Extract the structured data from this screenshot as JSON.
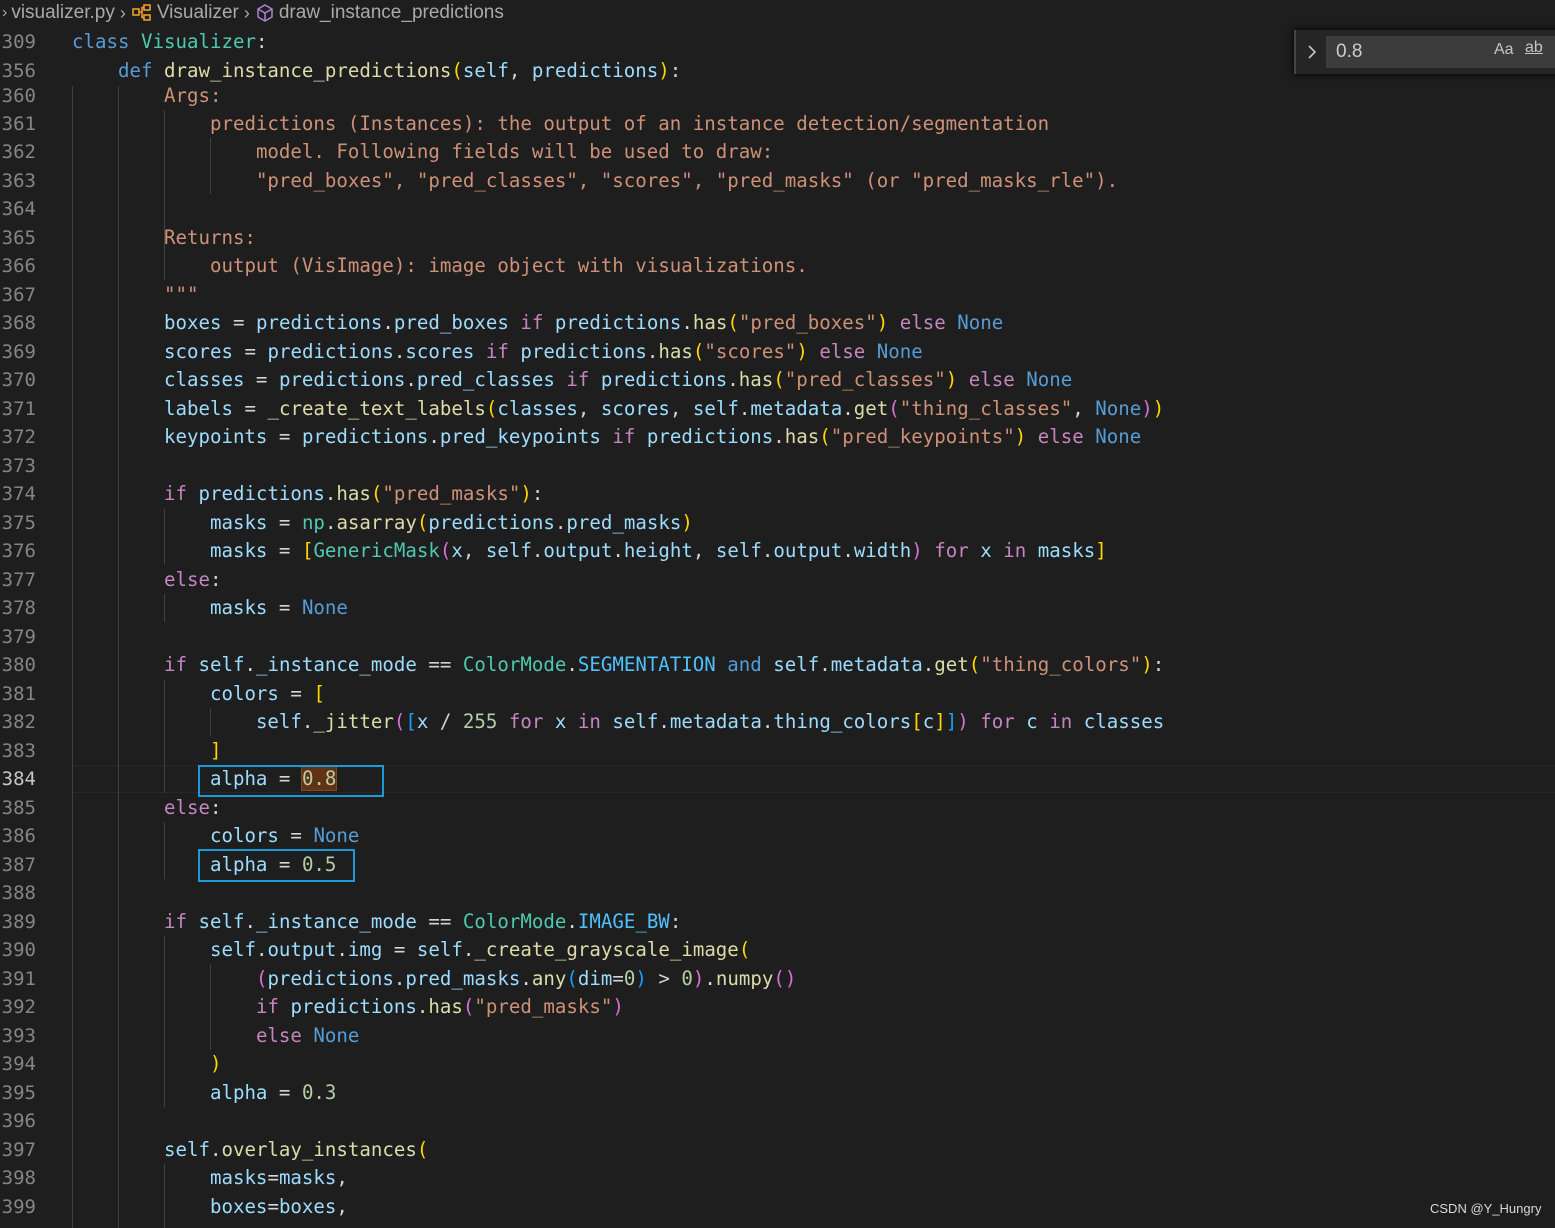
{
  "breadcrumb": {
    "file": "visualizer.py",
    "class_name": "Visualizer",
    "method_name": "draw_instance_predictions"
  },
  "find_widget": {
    "query": "0.8",
    "match_case_label": "Aa",
    "whole_word_label": "ab"
  },
  "watermark": "CSDN @Y_Hungry",
  "active_line": "384",
  "line_numbers": {
    "l309": "309",
    "l356": "356",
    "l360": "360",
    "l361": "361",
    "l362": "362",
    "l363": "363",
    "l364": "364",
    "l365": "365",
    "l366": "366",
    "l367": "367",
    "l368": "368",
    "l369": "369",
    "l370": "370",
    "l371": "371",
    "l372": "372",
    "l373": "373",
    "l374": "374",
    "l375": "375",
    "l376": "376",
    "l377": "377",
    "l378": "378",
    "l379": "379",
    "l380": "380",
    "l381": "381",
    "l382": "382",
    "l383": "383",
    "l384": "384",
    "l385": "385",
    "l386": "386",
    "l387": "387",
    "l388": "388",
    "l389": "389",
    "l390": "390",
    "l391": "391",
    "l392": "392",
    "l393": "393",
    "l394": "394",
    "l395": "395",
    "l396": "396",
    "l397": "397",
    "l398": "398",
    "l399": "399"
  },
  "code": {
    "l309": [
      [
        "kw-def",
        "class "
      ],
      [
        "cls",
        "Visualizer"
      ],
      [
        "plain",
        ":"
      ]
    ],
    "l356": [
      [
        "plain",
        "    "
      ],
      [
        "def",
        "def "
      ],
      [
        "fn",
        "draw_instance_predictions"
      ],
      [
        "b1",
        "("
      ],
      [
        "var",
        "self"
      ],
      [
        "plain",
        ", "
      ],
      [
        "var",
        "predictions"
      ],
      [
        "b1",
        ")"
      ],
      [
        "plain",
        ":"
      ]
    ],
    "l360": [
      [
        "plain",
        "        "
      ],
      [
        "doc",
        "Args:"
      ]
    ],
    "l361": [
      [
        "plain",
        "            "
      ],
      [
        "doc",
        "predictions (Instances): the output of an instance detection/segmentation"
      ]
    ],
    "l362": [
      [
        "plain",
        "                "
      ],
      [
        "doc",
        "model. Following fields will be used to draw:"
      ]
    ],
    "l363": [
      [
        "plain",
        "                "
      ],
      [
        "doc",
        "\"pred_boxes\", \"pred_classes\", \"scores\", \"pred_masks\" (or \"pred_masks_rle\")."
      ]
    ],
    "l364": [],
    "l365": [
      [
        "plain",
        "        "
      ],
      [
        "doc",
        "Returns:"
      ]
    ],
    "l366": [
      [
        "plain",
        "            "
      ],
      [
        "doc",
        "output (VisImage): image object with visualizations."
      ]
    ],
    "l367": [
      [
        "plain",
        "        "
      ],
      [
        "doc",
        "\"\"\""
      ]
    ],
    "l368": [
      [
        "plain",
        "        "
      ],
      [
        "var",
        "boxes"
      ],
      [
        "plain",
        " = "
      ],
      [
        "var",
        "predictions"
      ],
      [
        "plain",
        "."
      ],
      [
        "var",
        "pred_boxes"
      ],
      [
        "plain",
        " "
      ],
      [
        "kw",
        "if"
      ],
      [
        "plain",
        " "
      ],
      [
        "var",
        "predictions"
      ],
      [
        "plain",
        "."
      ],
      [
        "fn",
        "has"
      ],
      [
        "b1",
        "("
      ],
      [
        "str",
        "\"pred_boxes\""
      ],
      [
        "b1",
        ")"
      ],
      [
        "plain",
        " "
      ],
      [
        "kw",
        "else"
      ],
      [
        "plain",
        " "
      ],
      [
        "def",
        "None"
      ]
    ],
    "l369": [
      [
        "plain",
        "        "
      ],
      [
        "var",
        "scores"
      ],
      [
        "plain",
        " = "
      ],
      [
        "var",
        "predictions"
      ],
      [
        "plain",
        "."
      ],
      [
        "var",
        "scores"
      ],
      [
        "plain",
        " "
      ],
      [
        "kw",
        "if"
      ],
      [
        "plain",
        " "
      ],
      [
        "var",
        "predictions"
      ],
      [
        "plain",
        "."
      ],
      [
        "fn",
        "has"
      ],
      [
        "b1",
        "("
      ],
      [
        "str",
        "\"scores\""
      ],
      [
        "b1",
        ")"
      ],
      [
        "plain",
        " "
      ],
      [
        "kw",
        "else"
      ],
      [
        "plain",
        " "
      ],
      [
        "def",
        "None"
      ]
    ],
    "l370": [
      [
        "plain",
        "        "
      ],
      [
        "var",
        "classes"
      ],
      [
        "plain",
        " = "
      ],
      [
        "var",
        "predictions"
      ],
      [
        "plain",
        "."
      ],
      [
        "var",
        "pred_classes"
      ],
      [
        "plain",
        " "
      ],
      [
        "kw",
        "if"
      ],
      [
        "plain",
        " "
      ],
      [
        "var",
        "predictions"
      ],
      [
        "plain",
        "."
      ],
      [
        "fn",
        "has"
      ],
      [
        "b1",
        "("
      ],
      [
        "str",
        "\"pred_classes\""
      ],
      [
        "b1",
        ")"
      ],
      [
        "plain",
        " "
      ],
      [
        "kw",
        "else"
      ],
      [
        "plain",
        " "
      ],
      [
        "def",
        "None"
      ]
    ],
    "l371": [
      [
        "plain",
        "        "
      ],
      [
        "var",
        "labels"
      ],
      [
        "plain",
        " = "
      ],
      [
        "fn",
        "_create_text_labels"
      ],
      [
        "b1",
        "("
      ],
      [
        "var",
        "classes"
      ],
      [
        "plain",
        ", "
      ],
      [
        "var",
        "scores"
      ],
      [
        "plain",
        ", "
      ],
      [
        "var",
        "self"
      ],
      [
        "plain",
        "."
      ],
      [
        "var",
        "metadata"
      ],
      [
        "plain",
        "."
      ],
      [
        "fn",
        "get"
      ],
      [
        "b2",
        "("
      ],
      [
        "str",
        "\"thing_classes\""
      ],
      [
        "plain",
        ", "
      ],
      [
        "def",
        "None"
      ],
      [
        "b2",
        ")"
      ],
      [
        "b1",
        ")"
      ]
    ],
    "l372": [
      [
        "plain",
        "        "
      ],
      [
        "var",
        "keypoints"
      ],
      [
        "plain",
        " = "
      ],
      [
        "var",
        "predictions"
      ],
      [
        "plain",
        "."
      ],
      [
        "var",
        "pred_keypoints"
      ],
      [
        "plain",
        " "
      ],
      [
        "kw",
        "if"
      ],
      [
        "plain",
        " "
      ],
      [
        "var",
        "predictions"
      ],
      [
        "plain",
        "."
      ],
      [
        "fn",
        "has"
      ],
      [
        "b1",
        "("
      ],
      [
        "str",
        "\"pred_keypoints\""
      ],
      [
        "b1",
        ")"
      ],
      [
        "plain",
        " "
      ],
      [
        "kw",
        "else"
      ],
      [
        "plain",
        " "
      ],
      [
        "def",
        "None"
      ]
    ],
    "l373": [],
    "l374": [
      [
        "plain",
        "        "
      ],
      [
        "kw",
        "if"
      ],
      [
        "plain",
        " "
      ],
      [
        "var",
        "predictions"
      ],
      [
        "plain",
        "."
      ],
      [
        "fn",
        "has"
      ],
      [
        "b1",
        "("
      ],
      [
        "str",
        "\"pred_masks\""
      ],
      [
        "b1",
        ")"
      ],
      [
        "plain",
        ":"
      ]
    ],
    "l375": [
      [
        "plain",
        "            "
      ],
      [
        "var",
        "masks"
      ],
      [
        "plain",
        " = "
      ],
      [
        "cls",
        "np"
      ],
      [
        "plain",
        "."
      ],
      [
        "fn",
        "asarray"
      ],
      [
        "b1",
        "("
      ],
      [
        "var",
        "predictions"
      ],
      [
        "plain",
        "."
      ],
      [
        "var",
        "pred_masks"
      ],
      [
        "b1",
        ")"
      ]
    ],
    "l376": [
      [
        "plain",
        "            "
      ],
      [
        "var",
        "masks"
      ],
      [
        "plain",
        " = "
      ],
      [
        "b1",
        "["
      ],
      [
        "cls",
        "GenericMask"
      ],
      [
        "b2",
        "("
      ],
      [
        "var",
        "x"
      ],
      [
        "plain",
        ", "
      ],
      [
        "var",
        "self"
      ],
      [
        "plain",
        "."
      ],
      [
        "var",
        "output"
      ],
      [
        "plain",
        "."
      ],
      [
        "var",
        "height"
      ],
      [
        "plain",
        ", "
      ],
      [
        "var",
        "self"
      ],
      [
        "plain",
        "."
      ],
      [
        "var",
        "output"
      ],
      [
        "plain",
        "."
      ],
      [
        "var",
        "width"
      ],
      [
        "b2",
        ")"
      ],
      [
        "plain",
        " "
      ],
      [
        "kw",
        "for"
      ],
      [
        "plain",
        " "
      ],
      [
        "var",
        "x"
      ],
      [
        "plain",
        " "
      ],
      [
        "kw",
        "in"
      ],
      [
        "plain",
        " "
      ],
      [
        "var",
        "masks"
      ],
      [
        "b1",
        "]"
      ]
    ],
    "l377": [
      [
        "plain",
        "        "
      ],
      [
        "kw",
        "else"
      ],
      [
        "plain",
        ":"
      ]
    ],
    "l378": [
      [
        "plain",
        "            "
      ],
      [
        "var",
        "masks"
      ],
      [
        "plain",
        " = "
      ],
      [
        "def",
        "None"
      ]
    ],
    "l379": [],
    "l380": [
      [
        "plain",
        "        "
      ],
      [
        "kw",
        "if"
      ],
      [
        "plain",
        " "
      ],
      [
        "var",
        "self"
      ],
      [
        "plain",
        "."
      ],
      [
        "var",
        "_instance_mode"
      ],
      [
        "plain",
        " == "
      ],
      [
        "cls",
        "ColorMode"
      ],
      [
        "plain",
        "."
      ],
      [
        "const",
        "SEGMENTATION"
      ],
      [
        "plain",
        " "
      ],
      [
        "def",
        "and"
      ],
      [
        "plain",
        " "
      ],
      [
        "var",
        "self"
      ],
      [
        "plain",
        "."
      ],
      [
        "var",
        "metadata"
      ],
      [
        "plain",
        "."
      ],
      [
        "fn",
        "get"
      ],
      [
        "b1",
        "("
      ],
      [
        "str",
        "\"thing_colors\""
      ],
      [
        "b1",
        ")"
      ],
      [
        "plain",
        ":"
      ]
    ],
    "l381": [
      [
        "plain",
        "            "
      ],
      [
        "var",
        "colors"
      ],
      [
        "plain",
        " = "
      ],
      [
        "b1",
        "["
      ]
    ],
    "l382": [
      [
        "plain",
        "                "
      ],
      [
        "var",
        "self"
      ],
      [
        "plain",
        "."
      ],
      [
        "fn",
        "_jitter"
      ],
      [
        "b2",
        "("
      ],
      [
        "b3",
        "["
      ],
      [
        "var",
        "x"
      ],
      [
        "plain",
        " / "
      ],
      [
        "num",
        "255"
      ],
      [
        "plain",
        " "
      ],
      [
        "kw",
        "for"
      ],
      [
        "plain",
        " "
      ],
      [
        "var",
        "x"
      ],
      [
        "plain",
        " "
      ],
      [
        "kw",
        "in"
      ],
      [
        "plain",
        " "
      ],
      [
        "var",
        "self"
      ],
      [
        "plain",
        "."
      ],
      [
        "var",
        "metadata"
      ],
      [
        "plain",
        "."
      ],
      [
        "var",
        "thing_colors"
      ],
      [
        "b1",
        "["
      ],
      [
        "var",
        "c"
      ],
      [
        "b1",
        "]"
      ],
      [
        "b3",
        "]"
      ],
      [
        "b2",
        ")"
      ],
      [
        "plain",
        " "
      ],
      [
        "kw",
        "for"
      ],
      [
        "plain",
        " "
      ],
      [
        "var",
        "c"
      ],
      [
        "plain",
        " "
      ],
      [
        "kw",
        "in"
      ],
      [
        "plain",
        " "
      ],
      [
        "var",
        "classes"
      ]
    ],
    "l383": [
      [
        "plain",
        "            "
      ],
      [
        "b1",
        "]"
      ]
    ],
    "l384": [
      [
        "plain",
        "            "
      ],
      [
        "var",
        "alpha"
      ],
      [
        "plain",
        " = "
      ],
      [
        "num-hl",
        "0.8"
      ]
    ],
    "l385": [
      [
        "plain",
        "        "
      ],
      [
        "kw",
        "else"
      ],
      [
        "plain",
        ":"
      ]
    ],
    "l386": [
      [
        "plain",
        "            "
      ],
      [
        "var",
        "colors"
      ],
      [
        "plain",
        " = "
      ],
      [
        "def",
        "None"
      ]
    ],
    "l387": [
      [
        "plain",
        "            "
      ],
      [
        "var",
        "alpha"
      ],
      [
        "plain",
        " = "
      ],
      [
        "num",
        "0.5"
      ]
    ],
    "l388": [],
    "l389": [
      [
        "plain",
        "        "
      ],
      [
        "kw",
        "if"
      ],
      [
        "plain",
        " "
      ],
      [
        "var",
        "self"
      ],
      [
        "plain",
        "."
      ],
      [
        "var",
        "_instance_mode"
      ],
      [
        "plain",
        " == "
      ],
      [
        "cls",
        "ColorMode"
      ],
      [
        "plain",
        "."
      ],
      [
        "const",
        "IMAGE_BW"
      ],
      [
        "plain",
        ":"
      ]
    ],
    "l390": [
      [
        "plain",
        "            "
      ],
      [
        "var",
        "self"
      ],
      [
        "plain",
        "."
      ],
      [
        "var",
        "output"
      ],
      [
        "plain",
        "."
      ],
      [
        "var",
        "img"
      ],
      [
        "plain",
        " = "
      ],
      [
        "var",
        "self"
      ],
      [
        "plain",
        "."
      ],
      [
        "fn",
        "_create_grayscale_image"
      ],
      [
        "b1",
        "("
      ]
    ],
    "l391": [
      [
        "plain",
        "                "
      ],
      [
        "b2",
        "("
      ],
      [
        "var",
        "predictions"
      ],
      [
        "plain",
        "."
      ],
      [
        "var",
        "pred_masks"
      ],
      [
        "plain",
        "."
      ],
      [
        "fn",
        "any"
      ],
      [
        "b3",
        "("
      ],
      [
        "var",
        "dim"
      ],
      [
        "plain",
        "="
      ],
      [
        "num",
        "0"
      ],
      [
        "b3",
        ")"
      ],
      [
        "plain",
        " > "
      ],
      [
        "num",
        "0"
      ],
      [
        "b2",
        ")"
      ],
      [
        "plain",
        "."
      ],
      [
        "fn",
        "numpy"
      ],
      [
        "b2",
        "()"
      ]
    ],
    "l392": [
      [
        "plain",
        "                "
      ],
      [
        "kw",
        "if"
      ],
      [
        "plain",
        " "
      ],
      [
        "var",
        "predictions"
      ],
      [
        "plain",
        "."
      ],
      [
        "fn",
        "has"
      ],
      [
        "b2",
        "("
      ],
      [
        "str",
        "\"pred_masks\""
      ],
      [
        "b2",
        ")"
      ]
    ],
    "l393": [
      [
        "plain",
        "                "
      ],
      [
        "kw",
        "else"
      ],
      [
        "plain",
        " "
      ],
      [
        "def",
        "None"
      ]
    ],
    "l394": [
      [
        "plain",
        "            "
      ],
      [
        "b1",
        ")"
      ]
    ],
    "l395": [
      [
        "plain",
        "            "
      ],
      [
        "var",
        "alpha"
      ],
      [
        "plain",
        " = "
      ],
      [
        "num",
        "0.3"
      ]
    ],
    "l396": [],
    "l397": [
      [
        "plain",
        "        "
      ],
      [
        "var",
        "self"
      ],
      [
        "plain",
        "."
      ],
      [
        "fn",
        "overlay_instances"
      ],
      [
        "b1",
        "("
      ]
    ],
    "l398": [
      [
        "plain",
        "            "
      ],
      [
        "var",
        "masks"
      ],
      [
        "plain",
        "="
      ],
      [
        "var",
        "masks"
      ],
      [
        "plain",
        ","
      ]
    ],
    "l399": [
      [
        "plain",
        "            "
      ],
      [
        "var",
        "boxes"
      ],
      [
        "plain",
        "="
      ],
      [
        "var",
        "boxes"
      ],
      [
        "plain",
        ","
      ]
    ]
  }
}
